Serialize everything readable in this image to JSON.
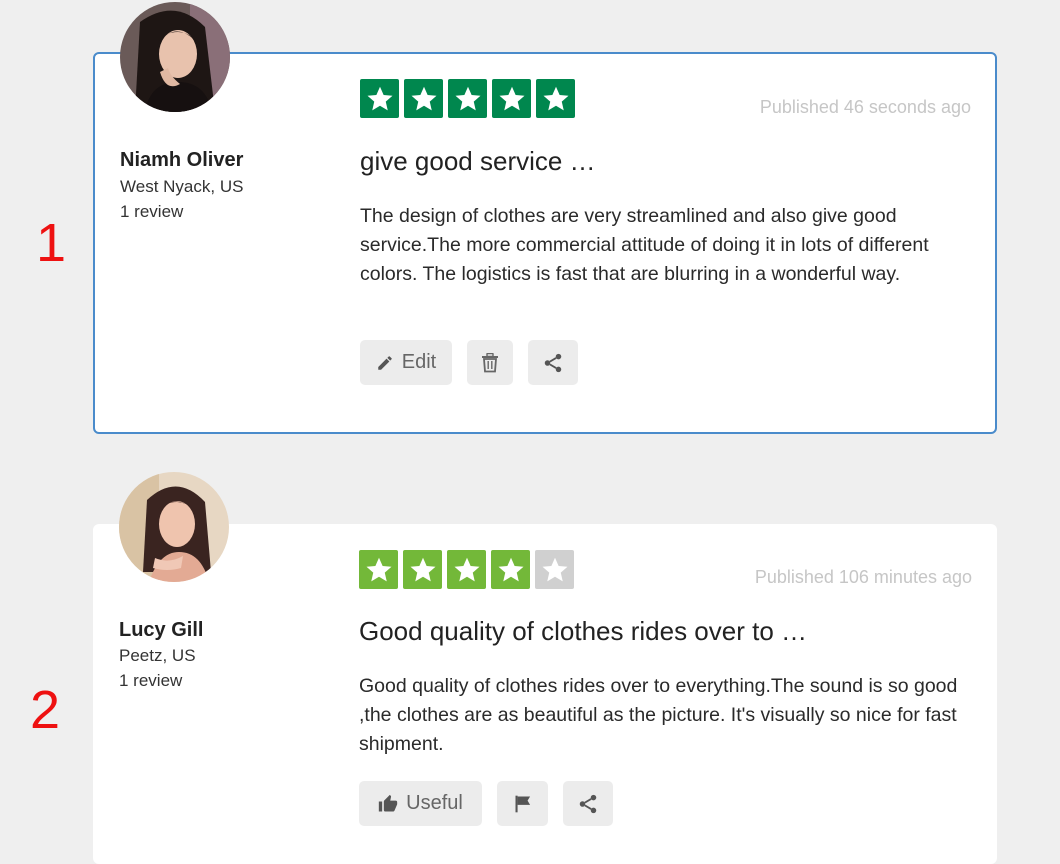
{
  "annotations": [
    "1",
    "2"
  ],
  "reviews": [
    {
      "author": "Niamh Oliver",
      "location": "West Nyack, US",
      "review_count": "1 review",
      "rating": 5,
      "star_color": "#00874e",
      "published": "Published 46 seconds ago",
      "title": "give good service …",
      "body": "The design of clothes are very streamlined and also give good service.The more commercial attitude of doing it in lots of different colors. The logistics is fast that are blurring in a wonderful way.",
      "actions": {
        "edit_label": "Edit"
      }
    },
    {
      "author": "Lucy Gill",
      "location": "Peetz, US",
      "review_count": "1 review",
      "rating": 4,
      "star_color": "#73b839",
      "published": "Published 106 minutes ago",
      "title": "Good quality of clothes rides over to …",
      "body": "Good quality of clothes rides over to everything.The sound is so good ,the clothes are as beautiful as the picture. It's visually so nice for fast shipment.",
      "actions": {
        "useful_label": "Useful"
      }
    }
  ],
  "colors": {
    "selected_border": "#4a8bcb",
    "empty_star": "#d0d0d0",
    "annotation": "#ee1111"
  },
  "icons": [
    "pencil-icon",
    "trash-icon",
    "share-icon",
    "thumbs-up-icon",
    "flag-icon",
    "star-icon"
  ]
}
